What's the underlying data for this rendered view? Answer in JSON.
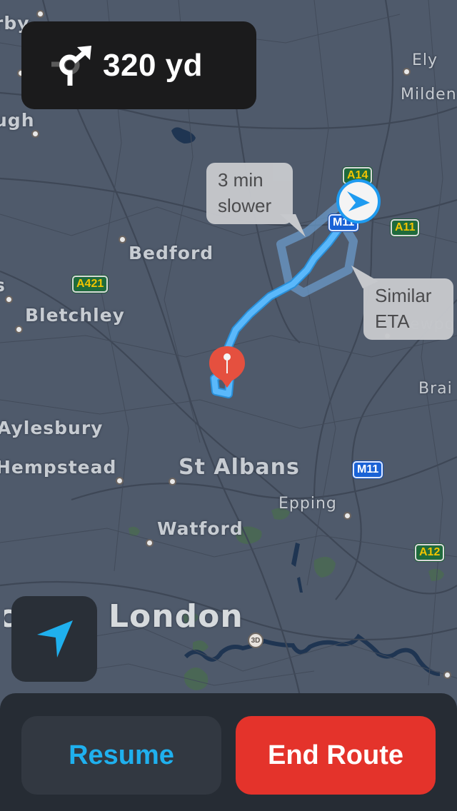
{
  "turn_instruction": {
    "maneuver_icon": "roundabout-exit-right-icon",
    "distance": "320 yd"
  },
  "route_callouts": [
    {
      "text_line1": "3 min",
      "text_line2": "slower"
    },
    {
      "text_line1": "Similar",
      "text_line2": "ETA"
    }
  ],
  "map": {
    "places": [
      {
        "name": "rby",
        "class": "med"
      },
      {
        "name": "ugh",
        "class": "med"
      },
      {
        "name": "Ely",
        "class": "small"
      },
      {
        "name": "Milden",
        "class": "small"
      },
      {
        "name": "Bedford",
        "class": "med"
      },
      {
        "name": "s",
        "class": "med"
      },
      {
        "name": "Bletchley",
        "class": "med"
      },
      {
        "name": "Aylesbury",
        "class": "med"
      },
      {
        "name": "Hempstead",
        "class": "med"
      },
      {
        "name": "St Albans",
        "class": "large"
      },
      {
        "name": "Epping",
        "class": "small"
      },
      {
        "name": "Watford",
        "class": "med"
      },
      {
        "name": "Brai",
        "class": "small"
      },
      {
        "name": "ewpo",
        "class": "small"
      },
      {
        "name": "London",
        "class": "xl"
      },
      {
        "name": "lc",
        "class": "xl"
      }
    ],
    "road_shields": [
      {
        "label": "A14",
        "type": "a"
      },
      {
        "label": "M11",
        "type": "m"
      },
      {
        "label": "A11",
        "type": "a"
      },
      {
        "label": "A421",
        "type": "a"
      },
      {
        "label": "M11",
        "type": "m"
      },
      {
        "label": "A12",
        "type": "a"
      }
    ],
    "threed_label": "3D",
    "route_color": "#5ab8fb",
    "alt_route_color": "#6a9ac8",
    "destination_pin_color": "#e5503f"
  },
  "controls": {
    "recenter_icon": "location-arrow-icon",
    "resume_label": "Resume",
    "end_route_label": "End Route"
  },
  "colors": {
    "accent_blue": "#1fb0ee",
    "end_red": "#e4332b",
    "panel_bg": "#262c34",
    "map_bg": "#4f5a6b"
  }
}
